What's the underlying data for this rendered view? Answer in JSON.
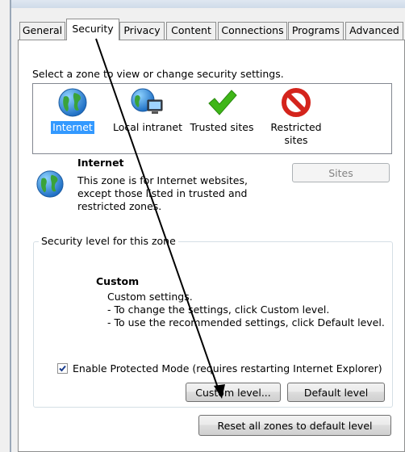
{
  "tabs": [
    "General",
    "Security",
    "Privacy",
    "Content",
    "Connections",
    "Programs",
    "Advanced"
  ],
  "active_tab": "Security",
  "zone_prompt": "Select a zone to view or change security settings.",
  "zones": [
    {
      "label": "Internet",
      "icon": "globe-icon",
      "selected": true
    },
    {
      "label": "Local intranet",
      "icon": "intranet-globe-icon",
      "selected": false
    },
    {
      "label": "Trusted sites",
      "icon": "checkmark-icon",
      "selected": false
    },
    {
      "label": "Restricted sites",
      "label_line1": "Restricted",
      "label_line2": "sites",
      "icon": "restricted-icon",
      "selected": false
    }
  ],
  "zone_info": {
    "title": "Internet",
    "line1": "This zone is for Internet websites,",
    "line2": "except those listed in trusted and",
    "line3": "restricted zones."
  },
  "sites_button": "Sites",
  "security_level": {
    "group_label": "Security level for this zone",
    "level_title": "Custom",
    "line1": "Custom settings.",
    "line2": "- To change the settings, click Custom level.",
    "line3": "- To use the recommended settings, click Default level."
  },
  "protected_mode": {
    "label": "Enable Protected Mode (requires restarting Internet Explorer)",
    "checked": true
  },
  "buttons": {
    "custom_level": "Custom level...",
    "default_level": "Default level",
    "reset_all": "Reset all zones to default level"
  },
  "colors": {
    "selection": "#3399ff",
    "check_green": "#3fb618",
    "restricted_red": "#d4241c",
    "globe_blue": "#1f6fc4"
  }
}
